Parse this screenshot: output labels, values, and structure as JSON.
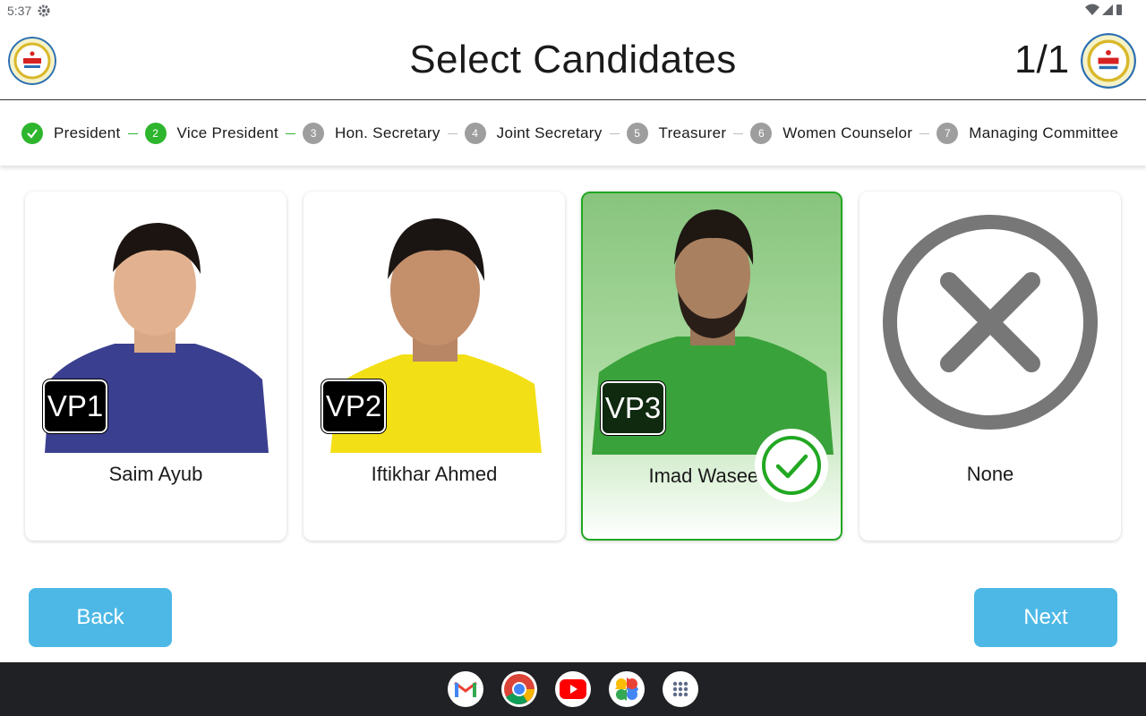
{
  "status_bar": {
    "time": "5:37"
  },
  "header": {
    "title": "Select Candidates",
    "counter": "1/1"
  },
  "steps": [
    {
      "label": "President",
      "num": "1",
      "state": "done"
    },
    {
      "label": "Vice President",
      "num": "2",
      "state": "active"
    },
    {
      "label": "Hon. Secretary",
      "num": "3",
      "state": "pending"
    },
    {
      "label": "Joint Secretary",
      "num": "4",
      "state": "pending"
    },
    {
      "label": "Treasurer",
      "num": "5",
      "state": "pending"
    },
    {
      "label": "Women Counselor",
      "num": "6",
      "state": "pending"
    },
    {
      "label": "Managing Committee",
      "num": "7",
      "state": "pending"
    }
  ],
  "candidates": [
    {
      "code": "VP1",
      "name": "Saim Ayub",
      "selected": false,
      "shirt": "#3b3f8f"
    },
    {
      "code": "VP2",
      "name": "Iftikhar Ahmed",
      "selected": false,
      "shirt": "#f3df16"
    },
    {
      "code": "VP3",
      "name": "Imad Waseem",
      "selected": true,
      "shirt": "#2f9a2f"
    },
    {
      "code": "",
      "name": "None",
      "selected": false
    }
  ],
  "buttons": {
    "back": "Back",
    "next": "Next"
  },
  "dock_apps": [
    "gmail-icon",
    "chrome-icon",
    "youtube-icon",
    "photos-icon",
    "app-drawer-icon"
  ],
  "colors": {
    "accent": "#4db8e6",
    "success": "#2db52d"
  }
}
